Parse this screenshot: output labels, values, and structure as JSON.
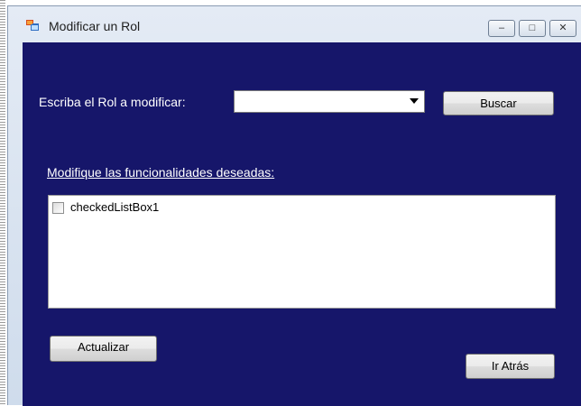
{
  "window": {
    "title": "Modificar un Rol",
    "icon": "form-app-icon",
    "controls": [
      {
        "name": "minimize",
        "glyph": "–"
      },
      {
        "name": "maximize",
        "glyph": "□"
      },
      {
        "name": "close",
        "glyph": "✕"
      }
    ]
  },
  "form": {
    "rol_label": "Escriba el Rol a modificar:",
    "rol_combo_value": "",
    "buscar_button": "Buscar",
    "funcionalidades_label": "Modifique las funcionalidades deseadas:",
    "checked_list": [
      {
        "label": "checkedListBox1",
        "checked": false
      }
    ],
    "actualizar_button": "Actualizar",
    "atras_button": "Ir Atrás"
  },
  "colors": {
    "client_background": "#16166a",
    "label_text": "#ffffff"
  }
}
